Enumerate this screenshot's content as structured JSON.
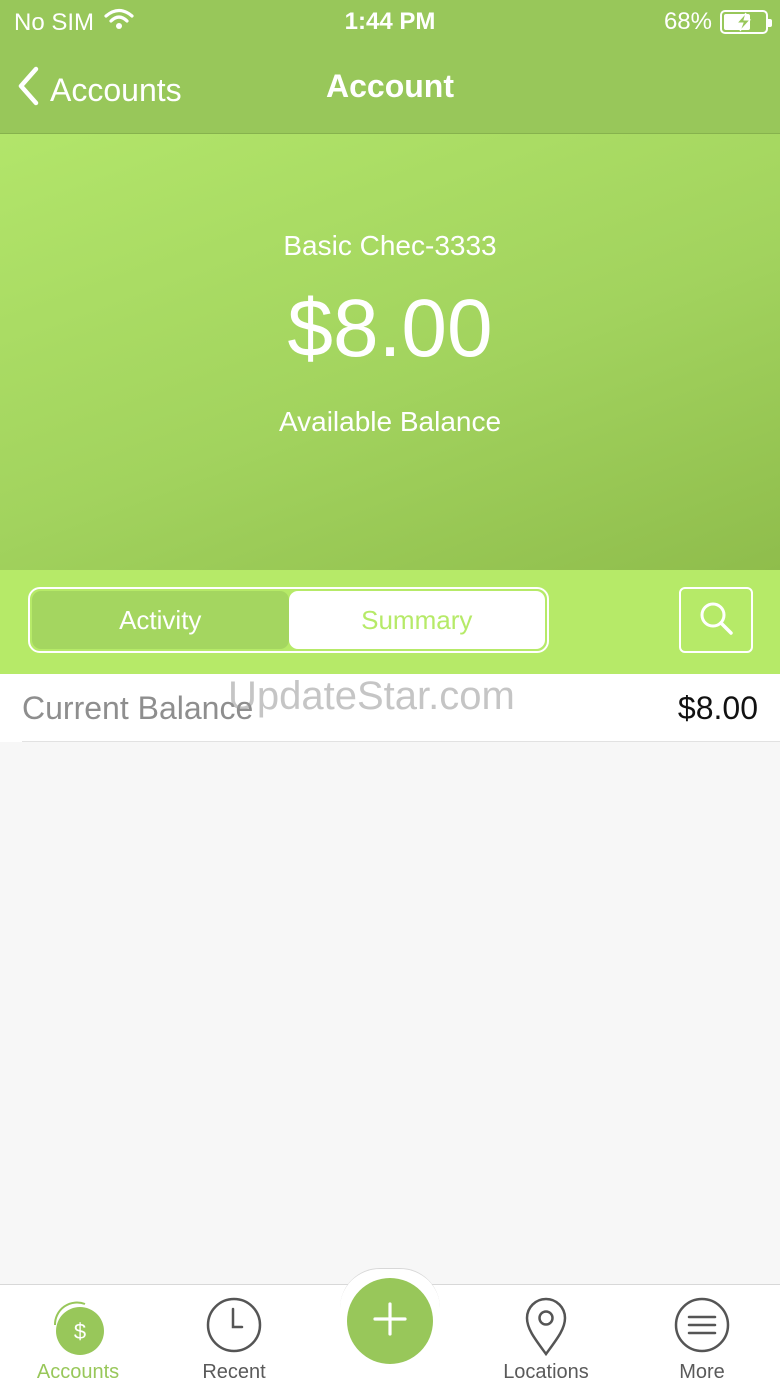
{
  "status_bar": {
    "carrier": "No SIM",
    "time": "1:44 PM",
    "battery": "68%"
  },
  "nav": {
    "back_label": "Accounts",
    "title": "Account"
  },
  "account": {
    "name": "Basic Chec-3333",
    "balance": "$8.00",
    "balance_label": "Available Balance"
  },
  "segments": {
    "activity": "Activity",
    "summary": "Summary",
    "selected": "Summary"
  },
  "summary_rows": [
    {
      "label": "Current Balance",
      "value": "$8.00"
    }
  ],
  "watermark": "UpdateStar.com",
  "tabbar": {
    "items": [
      {
        "label": "Accounts",
        "icon": "accounts-dollar-icon",
        "active": true
      },
      {
        "label": "Recent",
        "icon": "clock-icon",
        "active": false
      },
      {
        "label": "",
        "icon": "plus-icon",
        "active": false
      },
      {
        "label": "Locations",
        "icon": "location-pin-icon",
        "active": false
      },
      {
        "label": "More",
        "icon": "menu-icon",
        "active": false
      }
    ],
    "accounts_glyph": "$"
  },
  "colors": {
    "brand_green": "#98c75a",
    "tab_strip": "#b6ea68",
    "text_dark": "#111111",
    "label_gray": "#8e8e8e"
  }
}
